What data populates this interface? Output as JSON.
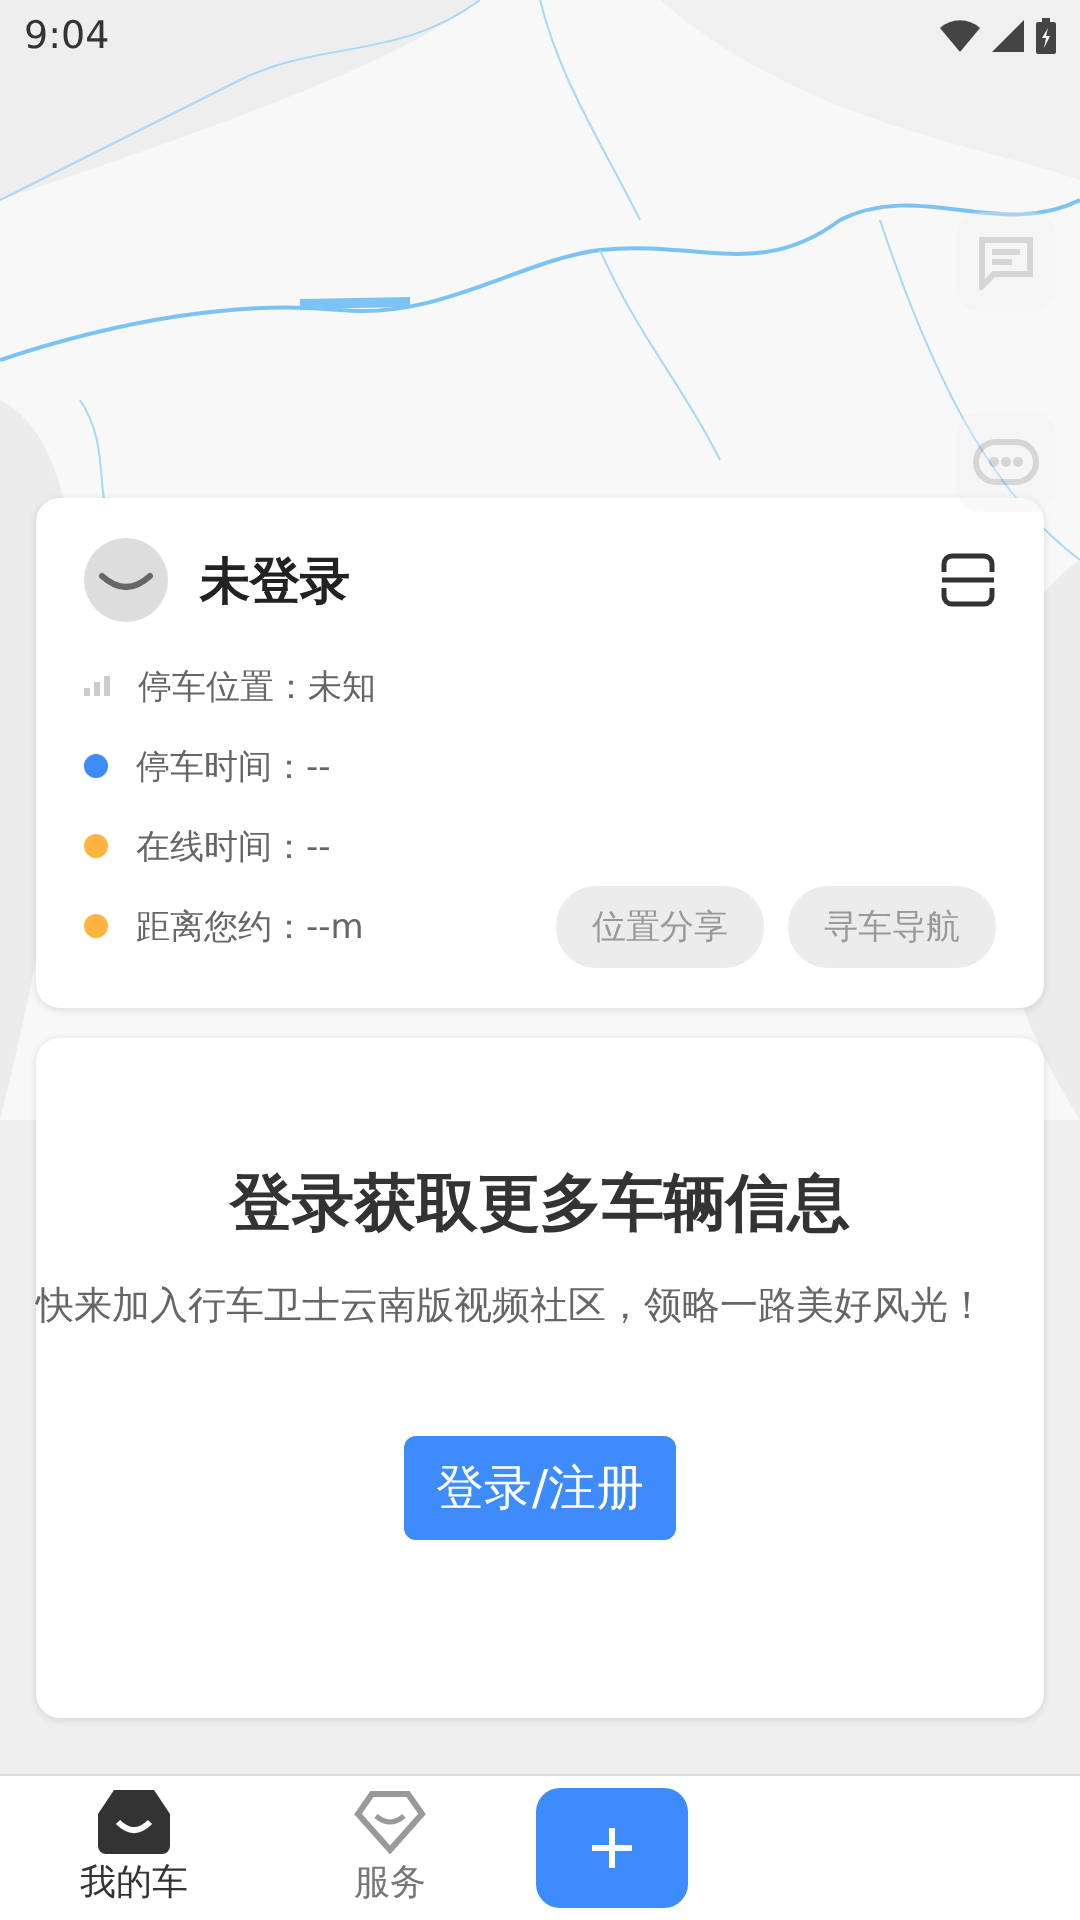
{
  "status_bar": {
    "time": "9:04"
  },
  "car_card": {
    "title": "未登录",
    "rows": [
      {
        "kind": "bars",
        "label": "停车位置：未知"
      },
      {
        "kind": "dot",
        "color": "#3d8bfd",
        "label": "停车时间：--"
      },
      {
        "kind": "dot",
        "color": "#ffb340",
        "label": "在线时间：--"
      },
      {
        "kind": "dot",
        "color": "#ffb340",
        "label": "距离您约：--m"
      }
    ],
    "buttons": [
      "位置分享",
      "寻车导航"
    ]
  },
  "login_card": {
    "heading": "登录获取更多车辆信息",
    "text": "快来加入行车卫士云南版视频社区，领略一路美好风光！",
    "button": "登录/注册"
  },
  "bottom_nav": [
    {
      "kind": "tab",
      "label": "我的车",
      "selected": true
    },
    {
      "kind": "tab",
      "label": "服务",
      "selected": false
    },
    {
      "kind": "add"
    }
  ]
}
